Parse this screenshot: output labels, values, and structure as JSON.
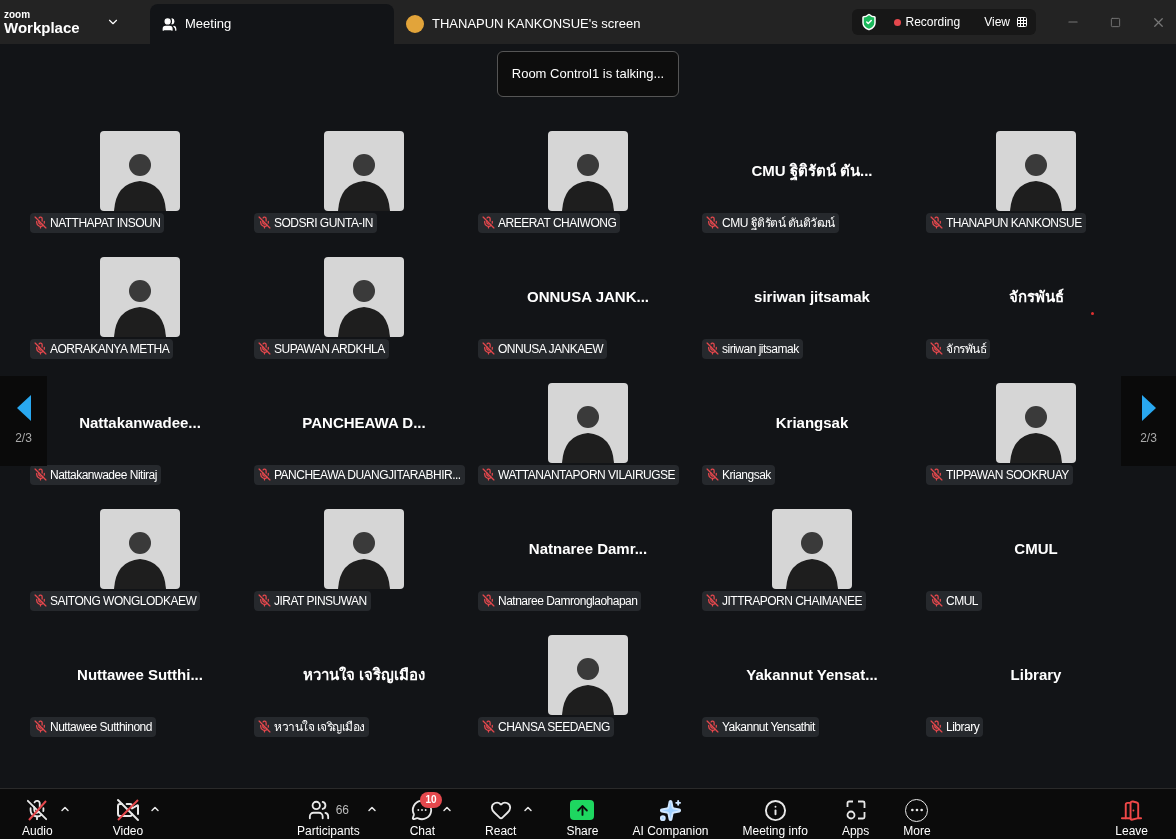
{
  "brand": {
    "top": "zoom",
    "bottom": "Workplace"
  },
  "tabs": [
    {
      "label": "Meeting",
      "selected": true,
      "kind": "meeting"
    },
    {
      "label": "THANAPUN KANKONSUE's screen",
      "selected": false,
      "kind": "screen"
    }
  ],
  "recording": {
    "label": "Recording"
  },
  "view": {
    "label": "View"
  },
  "talking": "Room Control1 is talking...",
  "pager": {
    "left": "2/3",
    "right": "2/3"
  },
  "tiles": [
    {
      "kind": "photo",
      "label": "NATTHAPAT INSOUN",
      "muted": true
    },
    {
      "kind": "photo",
      "label": "SODSRI GUNTA-IN",
      "muted": true
    },
    {
      "kind": "photo",
      "label": "AREERAT CHAIWONG",
      "muted": true
    },
    {
      "kind": "name",
      "display": "CMU ฐิติรัตน์ ตัน...",
      "label": "CMU ฐิติรัตน์ ตันติวัฒน์",
      "muted": true
    },
    {
      "kind": "photo",
      "label": "THANAPUN KANKONSUE",
      "muted": true
    },
    {
      "kind": "photo",
      "label": "AORRAKANYA METHA",
      "muted": true
    },
    {
      "kind": "photo",
      "label": "SUPAWAN ARDKHLA",
      "muted": true
    },
    {
      "kind": "name",
      "display": "ONNUSA JANK...",
      "label": "ONNUSA JANKAEW",
      "muted": true
    },
    {
      "kind": "name",
      "display": "siriwan jitsamak",
      "label": "siriwan jitsamak",
      "muted": true
    },
    {
      "kind": "name",
      "display": "จักรพันธ์",
      "label": "จักรพันธ์",
      "muted": true,
      "indicator": true
    },
    {
      "kind": "name",
      "display": "Nattakanwadee...",
      "label": "Nattakanwadee Nitiraj",
      "muted": true
    },
    {
      "kind": "name",
      "display": "PANCHEAWA D...",
      "label": "PANCHEAWA DUANGJITARABHIR...",
      "muted": true
    },
    {
      "kind": "photo",
      "label": "WATTANANTAPORN VILAIRUGSE",
      "muted": true
    },
    {
      "kind": "name",
      "display": "Kriangsak",
      "label": "Kriangsak",
      "muted": true
    },
    {
      "kind": "photo",
      "label": "TIPPAWAN SOOKRUAY",
      "muted": true
    },
    {
      "kind": "photo",
      "label": "SAITONG WONGLODKAEW",
      "muted": true
    },
    {
      "kind": "photo",
      "label": "JIRAT PINSUWAN",
      "muted": true
    },
    {
      "kind": "name",
      "display": "Natnaree Damr...",
      "label": "Natnaree Damronglaohapan",
      "muted": true
    },
    {
      "kind": "photo",
      "label": "JITTRAPORN CHAIMANEE",
      "muted": true
    },
    {
      "kind": "name",
      "display": "CMUL",
      "label": "CMUL",
      "muted": true
    },
    {
      "kind": "name",
      "display": "Nuttawee Sutthi...",
      "label": "Nuttawee Sutthinond",
      "muted": true
    },
    {
      "kind": "name",
      "display": "หวานใจ เจริญเมือง",
      "label": "หวานใจ เจริญเมือง",
      "muted": true
    },
    {
      "kind": "photo",
      "label": "CHANSA SEEDAENG",
      "muted": true
    },
    {
      "kind": "name",
      "display": "Yakannut Yensat...",
      "label": "Yakannut Yensathit",
      "muted": true
    },
    {
      "kind": "name",
      "display": "Library",
      "label": "Library",
      "muted": true
    }
  ],
  "toolbar": [
    {
      "kind": "audio",
      "label": "Audio",
      "caret": true
    },
    {
      "kind": "video",
      "label": "Video",
      "caret": true
    },
    {
      "kind": "participants",
      "label": "Participants",
      "count": "66",
      "caret": true
    },
    {
      "kind": "chat",
      "label": "Chat",
      "badge": "10",
      "caret": true
    },
    {
      "kind": "react",
      "label": "React",
      "caret": true
    },
    {
      "kind": "share",
      "label": "Share",
      "caret": false
    },
    {
      "kind": "ai",
      "label": "AI Companion",
      "caret": false
    },
    {
      "kind": "info",
      "label": "Meeting info",
      "caret": false
    },
    {
      "kind": "apps",
      "label": "Apps",
      "caret": false
    },
    {
      "kind": "more",
      "label": "More",
      "caret": false
    },
    {
      "kind": "leave",
      "label": "Leave",
      "caret": false
    }
  ]
}
